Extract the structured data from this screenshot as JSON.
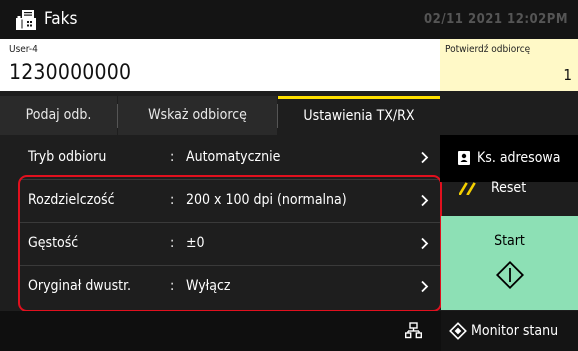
{
  "header": {
    "title": "Faks",
    "icon": "fax-icon",
    "datetime": "02/11 2021 12:02PM"
  },
  "destination": {
    "name": "User-4",
    "number": "1230000000"
  },
  "confirm": {
    "label": "Potwierdź odbiorcę",
    "count": "1"
  },
  "tabs": [
    {
      "label": "Podaj odb."
    },
    {
      "label": "Wskaż odbiorcę"
    },
    {
      "label": "Ustawienia TX/RX"
    }
  ],
  "settings": [
    {
      "label": "Tryb odbioru",
      "colon": ":",
      "value": "Automatycznie"
    },
    {
      "label": "Rozdzielczość",
      "colon": ":",
      "value": "200 x 100 dpi (normalna)"
    },
    {
      "label": "Gęstość",
      "colon": ":",
      "value": "±0"
    },
    {
      "label": "Oryginał dwustr.",
      "colon": ":",
      "value": "Wyłącz"
    }
  ],
  "side": {
    "address_book_label": "Ks. adresowa",
    "reset_label": "Reset",
    "start_label": "Start"
  },
  "footer": {
    "monitor_label": "Monitor stanu"
  },
  "colors": {
    "accent_tab": "#ffe000",
    "start": "#8de0b5",
    "highlight": "#e1101e",
    "confirm_bg": "#fff9c7"
  }
}
